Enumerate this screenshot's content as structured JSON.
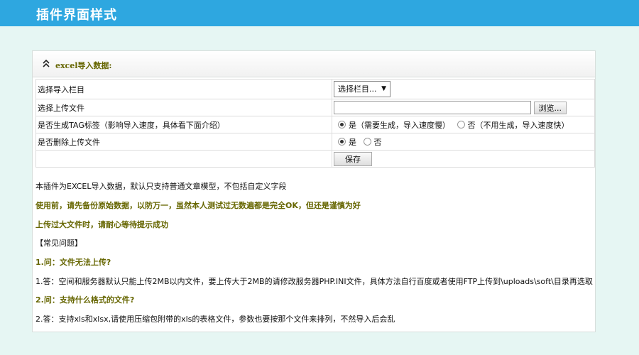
{
  "header": {
    "title": "插件界面样式"
  },
  "panel": {
    "title": "excel导入数据:",
    "collapse_icon": "double-chevron-up-icon"
  },
  "form": {
    "column_label": "选择导入栏目",
    "column_select_value": "选择栏目...",
    "upload_label": "选择上传文件",
    "file_value": "",
    "browse_label": "浏览...",
    "tag_label": "是否生成TAG标签（影响导入速度，具体看下面介绍）",
    "tag_yes": "是（需要生成，导入速度慢）",
    "tag_no": "否（不用生成，导入速度快）",
    "delete_label": "是否删除上传文件",
    "delete_yes": "是",
    "delete_no": "否",
    "save_label": "保存"
  },
  "info": {
    "line1": "本插件为EXCEL导入数据，默认只支持普通文章模型，不包括自定义字段",
    "line2": "使用前，请先备份原始数据，以防万一，虽然本人测试过无数遍都是完全OK，但还是谨慎为好",
    "line3": "上传过大文件时，请耐心等待提示成功",
    "faq_title": "【常见问题】",
    "q1": "1.问：文件无法上传?",
    "a1": "1.答：空间和服务器默认只能上传2MB以内文件，要上传大于2MB的请修改服务器PHP.INI文件，具体方法自行百度或者使用FTP上传到\\uploads\\soft\\目录再选取",
    "q2": "2.问：支持什么格式的文件?",
    "a2": "2.答：支持xls和xlsx,请使用压缩包附带的xls的表格文件，参数也要按那个文件来排列，不然导入后会乱"
  },
  "colors": {
    "topbar": "#2ea7e0",
    "background": "#e6f6f3",
    "accent_text": "#666600"
  }
}
